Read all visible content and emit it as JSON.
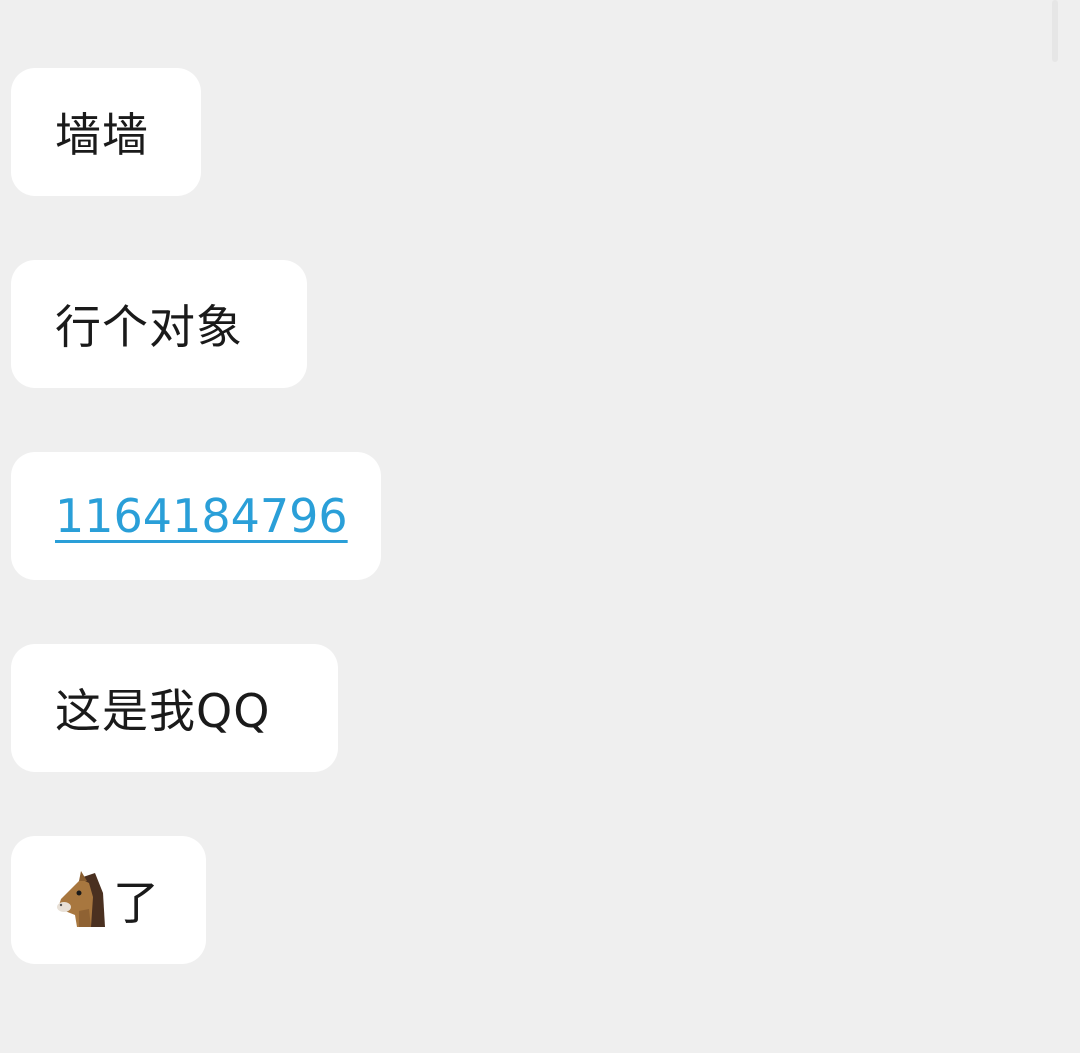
{
  "messages": [
    {
      "text": "墙墙"
    },
    {
      "text": "行个对象"
    },
    {
      "text": "1164184796"
    },
    {
      "text": "这是我QQ"
    },
    {
      "icon": "horse-emoji",
      "text": "了"
    }
  ],
  "colors": {
    "background": "#efefef",
    "bubble": "#ffffff",
    "text": "#1a1a1a",
    "link": "#2a9fd8"
  }
}
